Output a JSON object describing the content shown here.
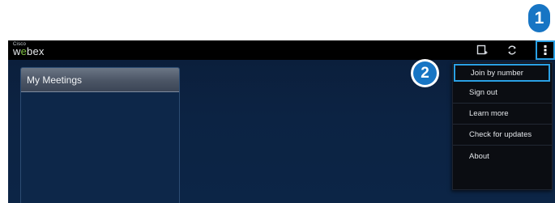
{
  "app": {
    "logo_small": "Cisco",
    "logo_prefix": "w",
    "logo_e": "e",
    "logo_suffix": "bex"
  },
  "action_bar": {
    "icons": [
      "new-meeting-icon",
      "sync-icon",
      "overflow-menu-icon"
    ]
  },
  "meetings_panel": {
    "title": "My Meetings"
  },
  "overflow_menu": {
    "items": [
      {
        "label": "Join by number"
      },
      {
        "label": "Sign out"
      },
      {
        "label": "Learn more"
      },
      {
        "label": "Check for updates"
      },
      {
        "label": "About"
      }
    ]
  },
  "callouts": {
    "step_1": "1",
    "step_2": "2"
  },
  "colors": {
    "highlight": "#2aa0e4",
    "callout": "#1775c4",
    "webex_green": "#7fc243",
    "background": "#0c2343"
  }
}
